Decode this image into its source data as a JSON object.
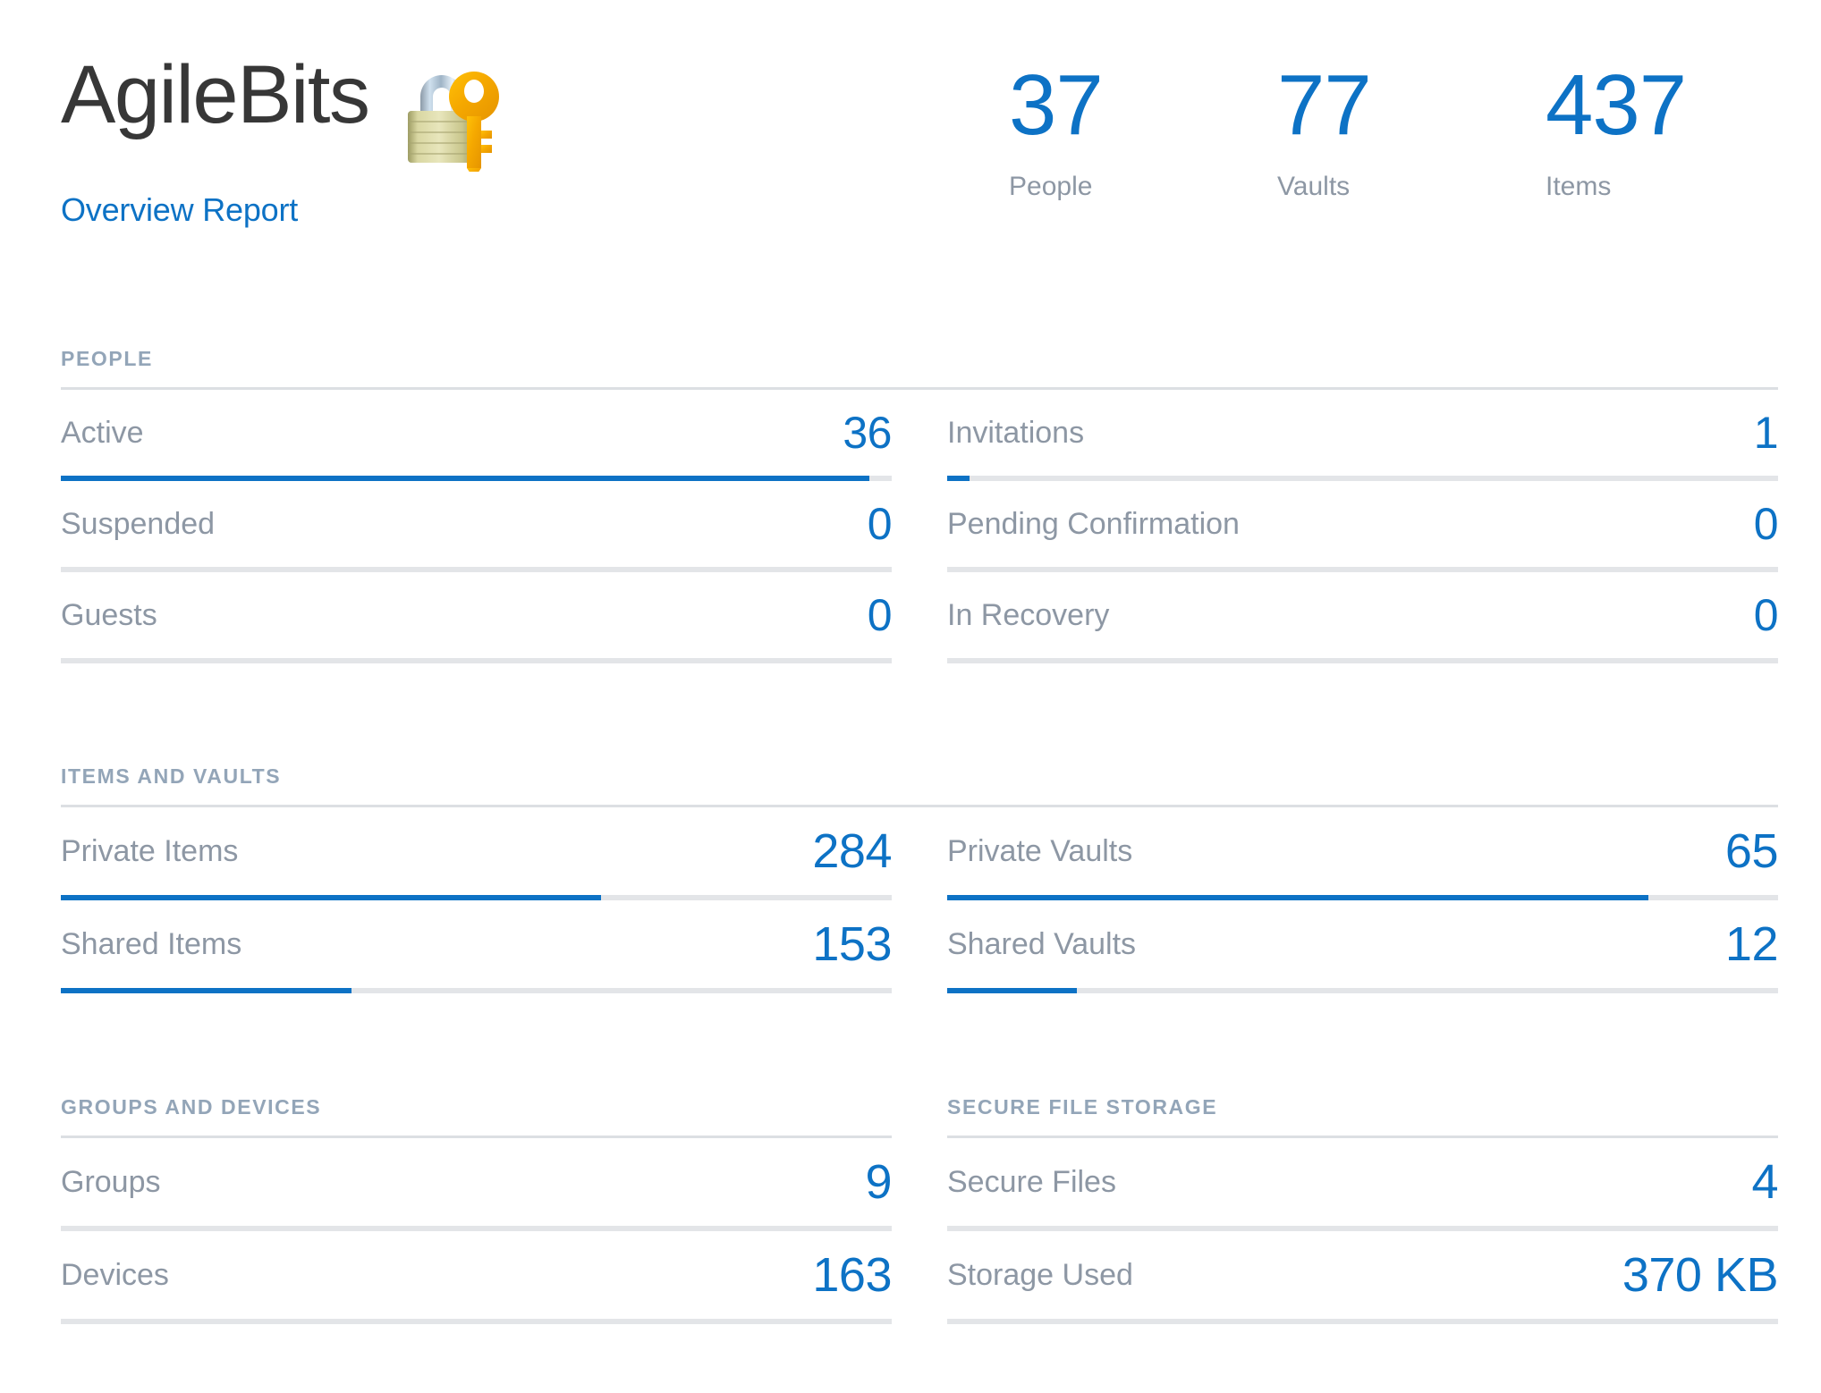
{
  "brand": {
    "title": "AgileBits",
    "subtitle": "Overview Report",
    "emoji_icon": "closed-lock-with-key"
  },
  "colors": {
    "accent": "#0d72c5",
    "label": "#8d97a4",
    "section_title": "#93a5b8",
    "rule": "#dcdfe3",
    "track": "#e3e5e8",
    "title_text": "#373737"
  },
  "kpis": [
    {
      "value": "37",
      "label": "People"
    },
    {
      "value": "77",
      "label": "Vaults"
    },
    {
      "value": "437",
      "label": "Items"
    }
  ],
  "sections": [
    {
      "id": "people",
      "title": "PEOPLE",
      "head_style": "full",
      "left": [
        {
          "label": "Active",
          "value": "36",
          "bar": true,
          "pct": 97.3
        },
        {
          "label": "Suspended",
          "value": "0",
          "bar": true,
          "pct": 0
        },
        {
          "label": "Guests",
          "value": "0",
          "bar": true,
          "pct": 0
        }
      ],
      "right": [
        {
          "label": "Invitations",
          "value": "1",
          "bar": true,
          "pct": 2.7
        },
        {
          "label": "Pending Confirmation",
          "value": "0",
          "bar": true,
          "pct": 0
        },
        {
          "label": "In Recovery",
          "value": "0",
          "bar": true,
          "pct": 0
        }
      ]
    },
    {
      "id": "items-and-vaults",
      "title": "ITEMS AND VAULTS",
      "head_style": "full",
      "left": [
        {
          "label": "Private Items",
          "value": "284",
          "bar": true,
          "pct": 65.0
        },
        {
          "label": "Shared Items",
          "value": "153",
          "bar": true,
          "pct": 35.0
        }
      ],
      "right": [
        {
          "label": "Private Vaults",
          "value": "65",
          "bar": true,
          "pct": 84.4
        },
        {
          "label": "Shared Vaults",
          "value": "12",
          "bar": true,
          "pct": 15.6
        }
      ]
    },
    {
      "id": "groups-devices-storage",
      "head_style": "split",
      "title_left": "GROUPS AND DEVICES",
      "title_right": "SECURE FILE STORAGE",
      "left": [
        {
          "label": "Groups",
          "value": "9",
          "bar": false,
          "pct": 0
        },
        {
          "label": "Devices",
          "value": "163",
          "bar": false,
          "pct": 0
        }
      ],
      "right": [
        {
          "label": "Secure Files",
          "value": "4",
          "bar": false,
          "pct": 0
        },
        {
          "label": "Storage Used",
          "value": "370 KB",
          "bar": false,
          "pct": 0
        }
      ]
    }
  ]
}
